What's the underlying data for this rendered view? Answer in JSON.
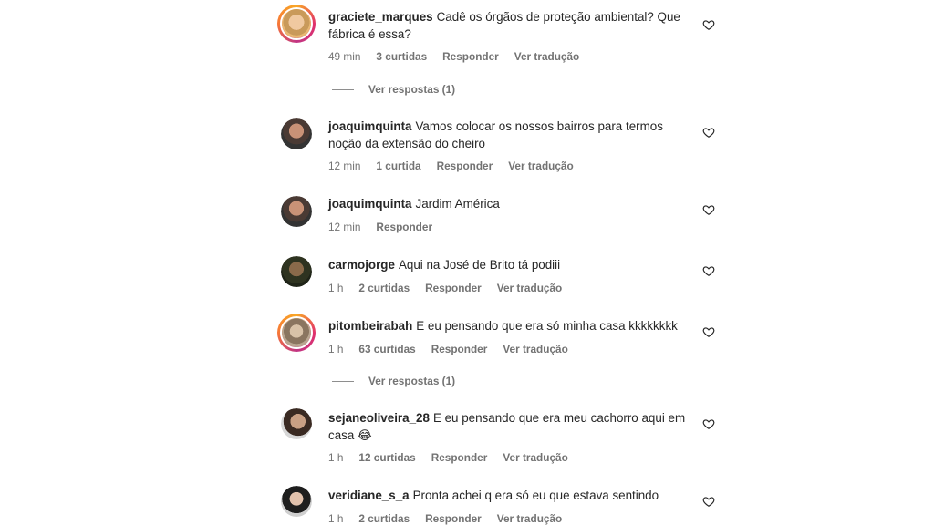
{
  "comments": [
    {
      "user": "graciete_marques",
      "text": "Cadê os órgãos de proteção ambiental? Que fábrica é essa?",
      "time": "49 min",
      "likes": "3 curtidas",
      "reply": "Responder",
      "translate": "Ver tradução"
    },
    {
      "user": "joaquimquinta",
      "text": "Vamos colocar os nossos bairros para termos noção da extensão do cheiro",
      "time": "12 min",
      "likes": "1 curtida",
      "reply": "Responder",
      "translate": "Ver tradução"
    },
    {
      "user": "joaquimquinta",
      "text": "Jardim América",
      "time": "12 min",
      "reply": "Responder"
    },
    {
      "user": "carmojorge",
      "text": "Aqui na José de Brito tá podiii",
      "time": "1 h",
      "likes": "2 curtidas",
      "reply": "Responder",
      "translate": "Ver tradução"
    },
    {
      "user": "pitombeirabah",
      "text": "E eu pensando que era só minha casa kkkkkkkk",
      "time": "1 h",
      "likes": "63 curtidas",
      "reply": "Responder",
      "translate": "Ver tradução"
    },
    {
      "user": "sejaneoliveira_28",
      "text": "E eu pensando que era meu cachorro aqui em casa 😂",
      "time": "1 h",
      "likes": "12 curtidas",
      "reply": "Responder",
      "translate": "Ver tradução"
    },
    {
      "user": "veridiane_s_a",
      "text": "Pronta achei q era só eu que estava sentindo",
      "time": "1 h",
      "likes": "2 curtidas",
      "reply": "Responder",
      "translate": "Ver tradução"
    }
  ],
  "replies": [
    {
      "label": "Ver respostas (1)"
    },
    {
      "label": "Ver respostas (1)"
    }
  ],
  "icons": {
    "like": "heart-outline-icon"
  },
  "colors": {
    "text": "#262626",
    "muted": "#737373",
    "story_ring": "#e1306c"
  }
}
